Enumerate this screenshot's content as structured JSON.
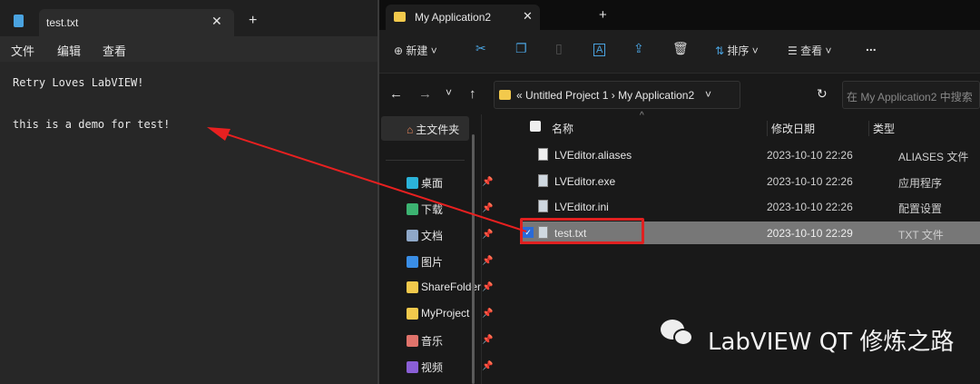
{
  "notepad": {
    "tab_title": "test.txt",
    "menu": [
      "文件",
      "编辑",
      "查看"
    ],
    "lines": [
      "Retry Loves LabVIEW!",
      "",
      "this is a demo for test!"
    ]
  },
  "explorer": {
    "tab_title": "My Application2",
    "toolbar": {
      "new": "新建",
      "sort": "排序",
      "view": "查看",
      "more": "..."
    },
    "breadcrumb": [
      "Untitled Project 1",
      "My Application2"
    ],
    "search_placeholder": "在 My Application2 中搜索",
    "nav": [
      {
        "label": "主文件夹",
        "icon": "home-icon"
      },
      {
        "label": "桌面",
        "icon": "desktop-icon"
      },
      {
        "label": "下载",
        "icon": "download-icon"
      },
      {
        "label": "文档",
        "icon": "document-icon"
      },
      {
        "label": "图片",
        "icon": "picture-icon"
      },
      {
        "label": "ShareFolder",
        "icon": "folder-icon"
      },
      {
        "label": "MyProject",
        "icon": "folder-icon"
      },
      {
        "label": "音乐",
        "icon": "music-icon"
      },
      {
        "label": "视频",
        "icon": "video-icon"
      }
    ],
    "columns": [
      "名称",
      "修改日期",
      "类型"
    ],
    "files": [
      {
        "name": "LVEditor.aliases",
        "date": "2023-10-10 22:26",
        "type": "ALIASES 文件",
        "selected": false
      },
      {
        "name": "LVEditor.exe",
        "date": "2023-10-10 22:26",
        "type": "应用程序",
        "selected": false
      },
      {
        "name": "LVEditor.ini",
        "date": "2023-10-10 22:26",
        "type": "配置设置",
        "selected": false
      },
      {
        "name": "test.txt",
        "date": "2023-10-10 22:29",
        "type": "TXT 文件",
        "selected": true
      }
    ]
  },
  "watermark": "LabVIEW QT 修炼之路",
  "colors": {
    "highlight": "#e02020",
    "selected_row": "#777777",
    "accent": "#4aa3e0"
  }
}
